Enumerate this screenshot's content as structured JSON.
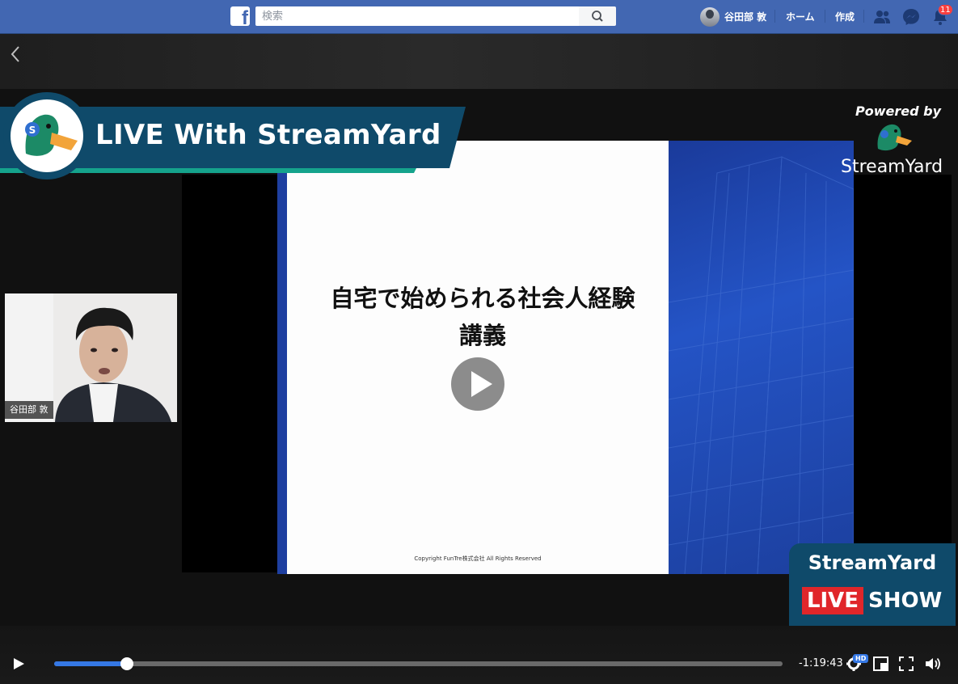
{
  "header": {
    "logo": "f",
    "search_placeholder": "検索",
    "user_name": "谷田部 敦",
    "home_label": "ホーム",
    "create_label": "作成",
    "notification_count": "11"
  },
  "video": {
    "banner_title": "LIVE With StreamYard",
    "powered_by": "Powered by",
    "powered_brand": "StreamYard",
    "slide_title_line1": "自宅で始められる社会人経験",
    "slide_title_line2": "講義",
    "slide_copyright": "Copyright  FunTre株式会社 All Rights Reserved",
    "camera_name": "谷田部 敦",
    "show_badge_top": "StreamYard",
    "show_badge_live": "LIVE",
    "show_badge_show": "SHOW"
  },
  "controls": {
    "time_remaining": "-1:19:43",
    "progress": 0.1,
    "quality_badge": "HD"
  }
}
